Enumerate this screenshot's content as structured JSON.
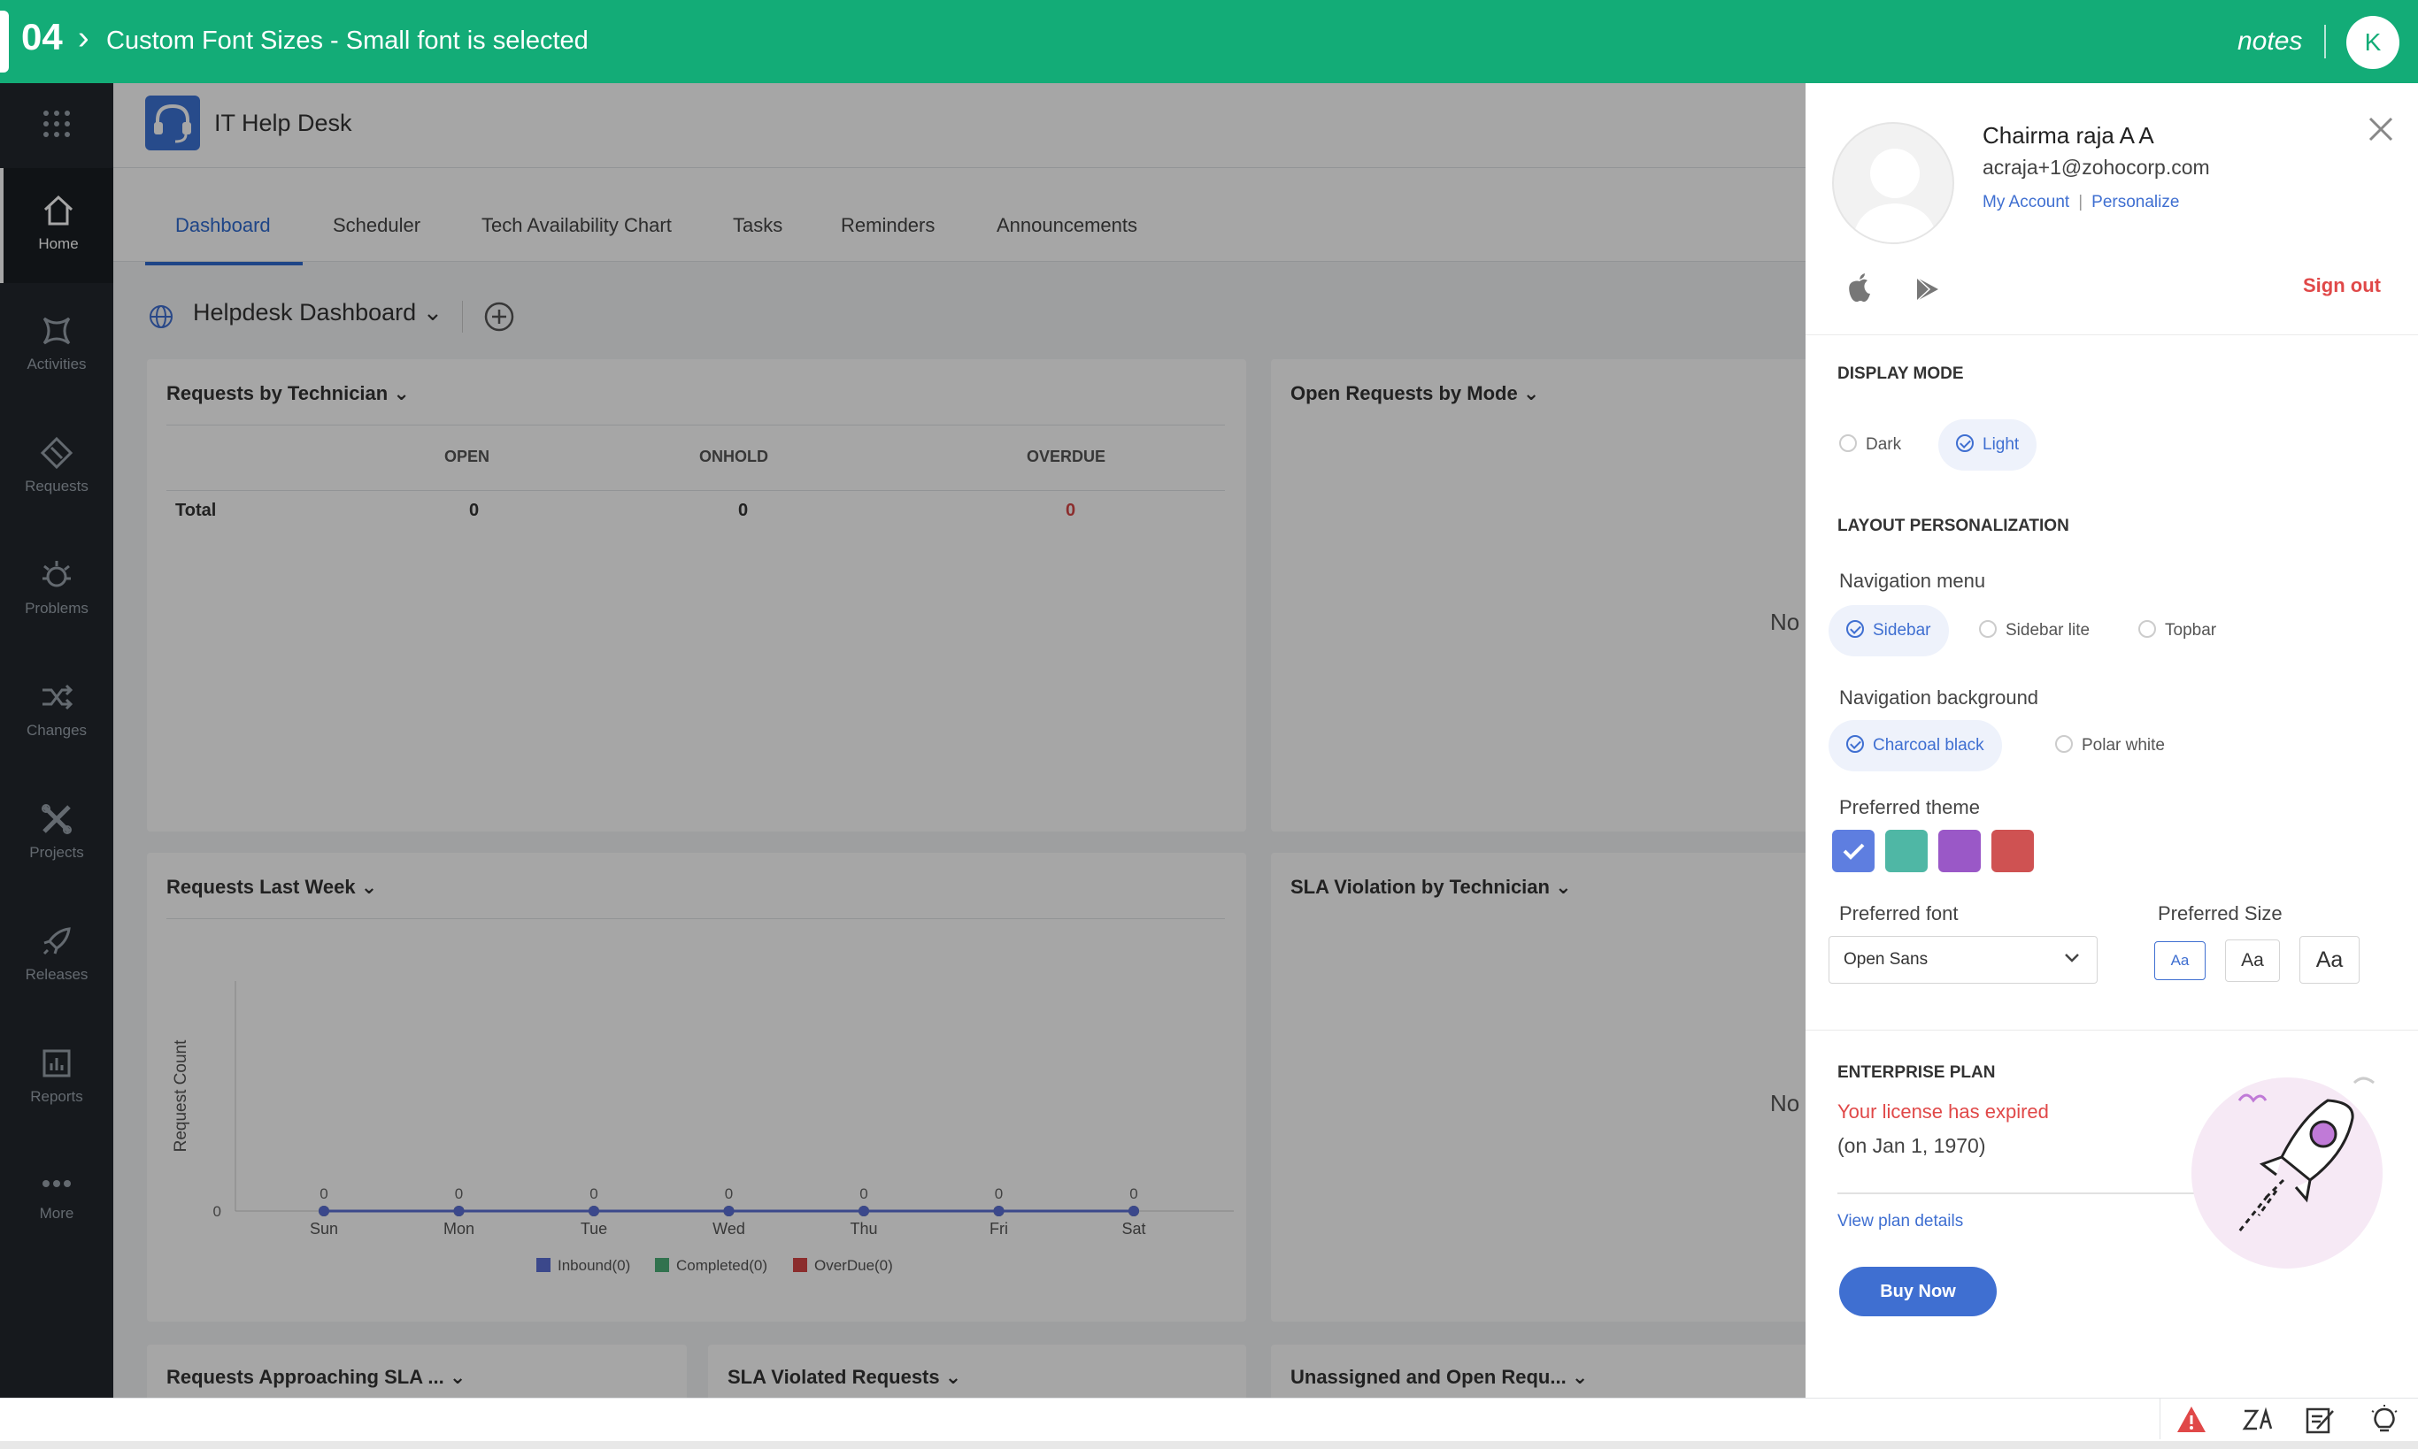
{
  "topbar": {
    "step": "04",
    "title": "Custom Font Sizes - Small font is selected",
    "notes": "notes",
    "avatar_letter": "K"
  },
  "sidebar": {
    "items": [
      {
        "label": "Home",
        "icon": "home-icon"
      },
      {
        "label": "Activities",
        "icon": "activities-icon"
      },
      {
        "label": "Requests",
        "icon": "requests-icon"
      },
      {
        "label": "Problems",
        "icon": "problems-icon"
      },
      {
        "label": "Changes",
        "icon": "changes-icon"
      },
      {
        "label": "Projects",
        "icon": "projects-icon"
      },
      {
        "label": "Releases",
        "icon": "releases-icon"
      },
      {
        "label": "Reports",
        "icon": "reports-icon"
      },
      {
        "label": "More",
        "icon": "more-icon"
      }
    ]
  },
  "app": {
    "name": "IT Help Desk",
    "tabs": [
      "Dashboard",
      "Scheduler",
      "Tech Availability Chart",
      "Tasks",
      "Reminders",
      "Announcements"
    ],
    "dashboard": "Helpdesk Dashboard"
  },
  "widgets": {
    "by_technician": {
      "title": "Requests by Technician",
      "headers": [
        "OPEN",
        "ONHOLD",
        "OVERDUE"
      ],
      "row_label": "Total",
      "values": [
        "0",
        "0",
        "0"
      ]
    },
    "by_mode": {
      "title": "Open Requests by Mode",
      "nodata": "No"
    },
    "last_week": {
      "title": "Requests Last Week",
      "ylabel": "Request Count",
      "ytick": "0",
      "legend": [
        "Inbound(0)",
        "Completed(0)",
        "OverDue(0)"
      ]
    },
    "sla_tech": {
      "title": "SLA Violation by Technician",
      "nodata": "No"
    },
    "approaching": {
      "title": "Requests Approaching SLA ..."
    },
    "sla_violated": {
      "title": "SLA Violated Requests"
    },
    "unassigned": {
      "title": "Unassigned and Open Requ..."
    }
  },
  "chart_data": {
    "type": "line",
    "title": "Requests Last Week",
    "ylabel": "Request Count",
    "categories": [
      "Sun",
      "Mon",
      "Tue",
      "Wed",
      "Thu",
      "Fri",
      "Sat"
    ],
    "series": [
      {
        "name": "Inbound(0)",
        "color": "#5b6fd6",
        "values": [
          0,
          0,
          0,
          0,
          0,
          0,
          0
        ]
      },
      {
        "name": "Completed(0)",
        "color": "#4caf78",
        "values": [
          0,
          0,
          0,
          0,
          0,
          0,
          0
        ]
      },
      {
        "name": "OverDue(0)",
        "color": "#d64545",
        "values": [
          0,
          0,
          0,
          0,
          0,
          0,
          0
        ]
      }
    ],
    "data_labels": [
      "0",
      "0",
      "0",
      "0",
      "0",
      "0",
      "0"
    ],
    "legend": "bottom",
    "grid": false
  },
  "profile": {
    "name": "Chairma raja A A",
    "email": "acraja+1@zohocorp.com",
    "my_account": "My Account",
    "separator": "|",
    "personalize": "Personalize",
    "sign_out": "Sign out"
  },
  "display_mode": {
    "heading": "DISPLAY MODE",
    "options": [
      "Dark",
      "Light"
    ],
    "selected": "Light"
  },
  "layout": {
    "heading": "LAYOUT PERSONALIZATION",
    "nav_menu": {
      "label": "Navigation menu",
      "options": [
        "Sidebar",
        "Sidebar lite",
        "Topbar"
      ],
      "selected": "Sidebar"
    },
    "nav_bg": {
      "label": "Navigation background",
      "options": [
        "Charcoal black",
        "Polar white"
      ],
      "selected": "Charcoal black"
    },
    "theme": {
      "label": "Preferred theme",
      "colors": [
        "#5e7ee0",
        "#4fb7a5",
        "#9a58c7",
        "#cf5252"
      ],
      "selected_index": 0
    },
    "font": {
      "label": "Preferred font",
      "value": "Open Sans"
    },
    "size": {
      "label": "Preferred Size",
      "options": [
        "Aa",
        "Aa",
        "Aa"
      ],
      "selected": "small"
    }
  },
  "plan": {
    "heading": "ENTERPRISE PLAN",
    "expired": "Your license has expired",
    "date": "(on Jan 1, 1970)",
    "details": "View plan details",
    "buy": "Buy Now"
  },
  "statusbar": {
    "icons": [
      "alert-icon",
      "zia-icon",
      "compose-icon",
      "bulb-icon"
    ]
  }
}
